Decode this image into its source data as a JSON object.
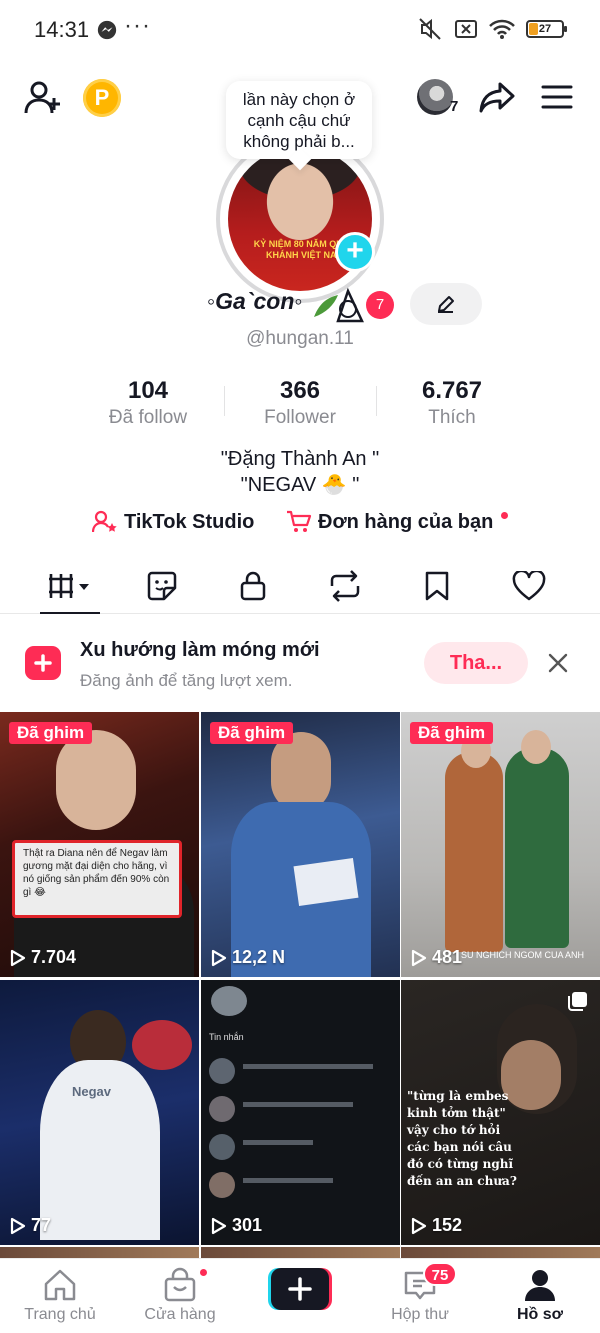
{
  "status_bar": {
    "time": "14:31",
    "dots": "···",
    "battery": "27",
    "icons": [
      "messenger-icon",
      "mute-icon",
      "sim-off-icon",
      "wifi-icon",
      "battery-icon"
    ]
  },
  "header": {
    "coin_label": "P",
    "friends_count": "7",
    "icons": [
      "add-friend-icon",
      "share-icon",
      "menu-icon"
    ]
  },
  "profile": {
    "bubble_note": "lần này chọn ở cạnh cậu chứ không phải b...",
    "avatar_caption": "KỶ NIỆM 80 NĂM QUỐC KHÁNH VIỆT NAM",
    "name": "◦Ga`con◦",
    "name_badge": "7",
    "handle": "@hungan.11",
    "stats": [
      {
        "value": "104",
        "label": "Đã follow"
      },
      {
        "value": "366",
        "label": "Follower"
      },
      {
        "value": "6.767",
        "label": "Thích"
      }
    ],
    "bio_line1": "\"Đặng Thành An \"",
    "bio_line2": "\"NEGAV 🐣 \"",
    "links": {
      "studio": "TikTok Studio",
      "orders": "Đơn hàng của bạn"
    }
  },
  "tabs": [
    "videos-grid-icon",
    "sticker-icon",
    "lock-icon",
    "repost-icon",
    "bookmark-icon",
    "heart-icon"
  ],
  "promo": {
    "title": "Xu hướng làm móng mới",
    "subtitle": "Đăng ảnh để tăng lượt xem.",
    "button": "Tha..."
  },
  "videos": [
    {
      "pinned": "Đã ghim",
      "views": "7.704",
      "caption": "Thật ra Diana nên để Negav làm gương mặt đại diện cho hãng, vì nó giống sản phẩm đến 90% còn gì 😂"
    },
    {
      "pinned": "Đã ghim",
      "views": "12,2 N",
      "caption": ""
    },
    {
      "pinned": "Đã ghim",
      "views": "481",
      "caption": "SU NGHICH NGOM CUA ANH"
    },
    {
      "pinned": "",
      "views": "77",
      "caption": "Negav"
    },
    {
      "pinned": "",
      "views": "301",
      "caption": "Tin nhắn"
    },
    {
      "pinned": "",
      "views": "152",
      "caption": "\"từng là embes kinh tởm thật\" vậy cho tớ hỏi các bạn nói câu đó có từng nghĩ đến an an chưa?"
    }
  ],
  "bottom_nav": {
    "home": "Trang chủ",
    "shop": "Cửa hàng",
    "inbox": "Hộp thư",
    "inbox_badge": "75",
    "profile": "Hồ sơ"
  },
  "colors": {
    "accent": "#fe2c55",
    "cyan": "#20d5ec",
    "text": "#161823",
    "muted": "#8a8b91"
  }
}
